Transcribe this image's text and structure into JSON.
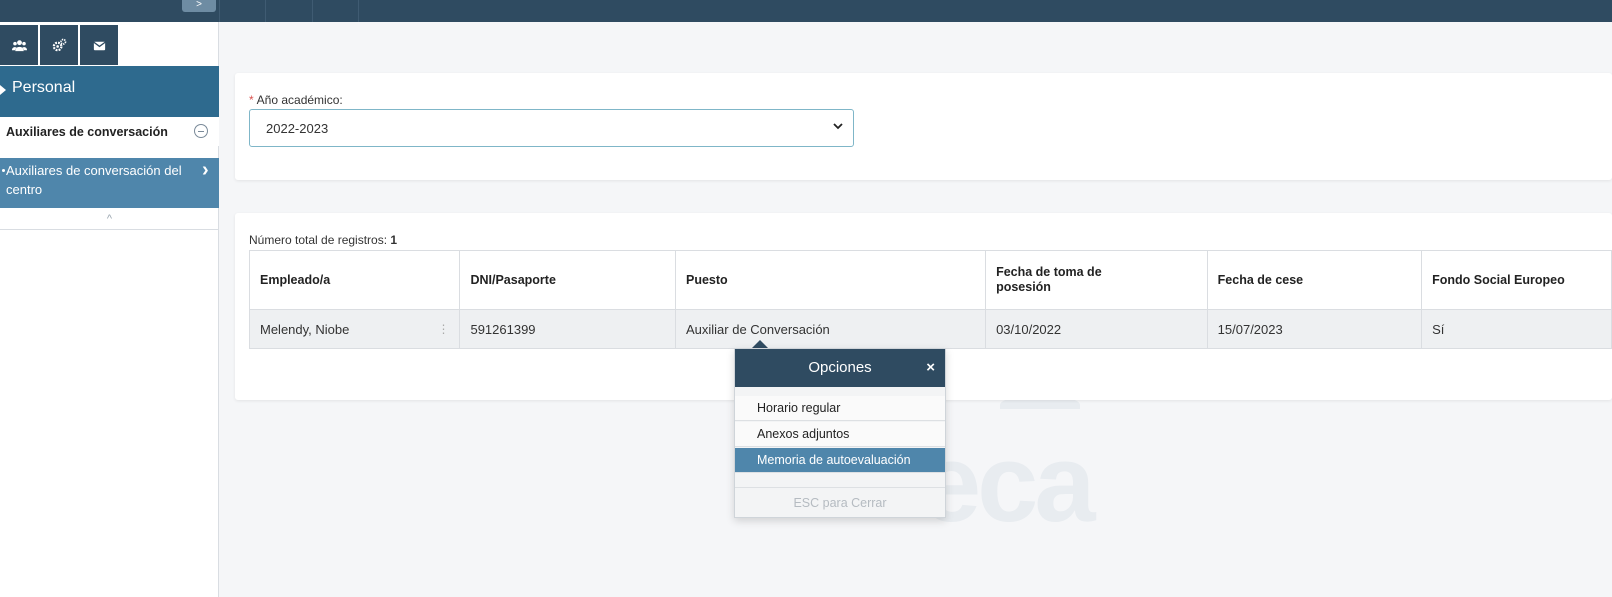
{
  "topbar": {
    "collapse_arrow": ">"
  },
  "sidebar": {
    "icons": [
      "users-icon",
      "cogs-icon",
      "envelope-icon"
    ],
    "header": "Personal",
    "group": "Auxiliares de conversación",
    "sub_item": "Auxiliares de conversación del centro",
    "collapse_arrow": "^"
  },
  "filters": {
    "year_label": "Año académico:",
    "year_value": "2022-2023"
  },
  "results": {
    "count_label": "Número total de registros:",
    "count_value": "1",
    "columns": [
      "Empleado/a",
      "DNI/Pasaporte",
      "Puesto",
      "Fecha de toma de posesión",
      "Fecha de cese",
      "Fondo Social Europeo"
    ],
    "rows": [
      [
        "Melendy, Niobe",
        "591261399",
        "Auxiliar de Conversación",
        "03/10/2022",
        "15/07/2023",
        "Sí"
      ]
    ]
  },
  "popup": {
    "title": "Opciones",
    "close": "×",
    "items": [
      "Horario regular",
      "Anexos adjuntos",
      "Memoria de autoevaluación"
    ],
    "footer": "ESC para Cerrar"
  },
  "watermark": "eca",
  "colors": {
    "navy": "#2f4b61",
    "teal": "#2e6a8e",
    "accent": "#4f86ab"
  }
}
